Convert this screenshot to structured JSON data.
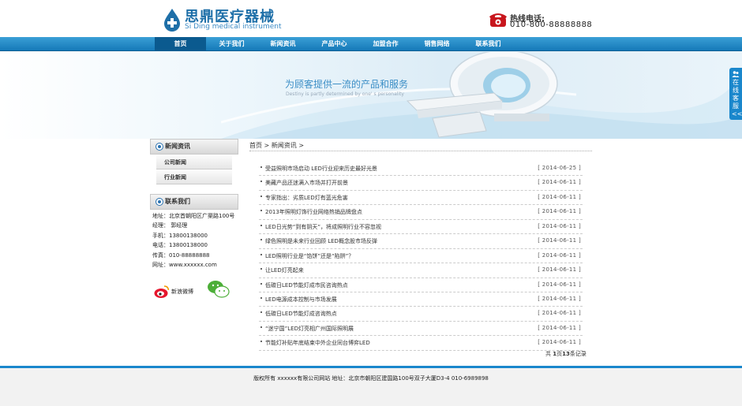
{
  "header": {
    "logo_cn": "思鼎医疗器械",
    "logo_en": "Si Ding medical instrument",
    "hotline_label": "热线电话:",
    "hotline_number": "010-800-88888888"
  },
  "nav": {
    "items": [
      {
        "label": "首页"
      },
      {
        "label": "关于我们"
      },
      {
        "label": "新闻资讯"
      },
      {
        "label": "产品中心"
      },
      {
        "label": "加盟合作"
      },
      {
        "label": "销售网络"
      },
      {
        "label": "联系我们"
      }
    ]
  },
  "banner": {
    "title": "为顾客提供一流的产品和服务",
    "subtitle": "Destiny is partly determined by one' s personality"
  },
  "side_service": {
    "text": "在线客服",
    "arrow": "<<"
  },
  "sidebar": {
    "news_heading": "新闻资讯",
    "news_items": [
      {
        "label": "公司新闻"
      },
      {
        "label": "行业新闻"
      }
    ],
    "contact_heading": "联系我们",
    "contact_lines": [
      "地址：北京首朝阳区广渠路100号",
      "经理：  郭经理",
      "手机：13800138000",
      "电话：13800138000",
      "传真：010-88888888",
      "网址：www.xxxxxx.com"
    ],
    "weibo_label": "新浪微博"
  },
  "main": {
    "breadcrumb": "首页 > 新闻资讯 >",
    "news": [
      {
        "title": "受益照明市场启动 LED行业迎来历史最好光景",
        "date": "[ 2014-06-25 ]"
      },
      {
        "title": "美藏产品还迷满入市场并打开前景",
        "date": "[ 2014-06-11 ]"
      },
      {
        "title": "专家指出：劣质LED灯有蓝光危害",
        "date": "[ 2014-06-11 ]"
      },
      {
        "title": "2013年照明灯饰行业网络热销品牌盘点",
        "date": "[ 2014-06-11 ]"
      },
      {
        "title": "LED日光势“到有阴天”，将成照明行业不容忽视",
        "date": "[ 2014-06-11 ]"
      },
      {
        "title": "绿色照明是未来行业回顾 LED概念股市场反弹",
        "date": "[ 2014-06-11 ]"
      },
      {
        "title": "LED照明行业是“馅饼”还是“陷阱”？",
        "date": "[ 2014-06-11 ]"
      },
      {
        "title": "让LED灯亮起来",
        "date": "[ 2014-06-11 ]"
      },
      {
        "title": "低碳日LED节能灯成市民咨询热点",
        "date": "[ 2014-06-11 ]"
      },
      {
        "title": "LED电源成本控制与市场发展",
        "date": "[ 2014-06-11 ]"
      },
      {
        "title": "低碳日LED节能灯成咨询热点",
        "date": "[ 2014-06-11 ]"
      },
      {
        "title": "“迷宁国”LED灯亮相广州国际照明展",
        "date": "[ 2014-06-11 ]"
      },
      {
        "title": "节能灯补贴年底结束中外企业同台博弈LED",
        "date": "[ 2014-06-11 ]"
      }
    ],
    "pager_prefix": "共",
    "pager_current": "1",
    "pager_mid": "页",
    "pager_total": "13",
    "pager_suffix": "条记录"
  },
  "footer": {
    "text": "版权所有 xxxxxx有限公司网站  地址：北京市朝阳区建国路100号双子大厦D3-4 010-6989898"
  },
  "colors": {
    "brand_blue": "#1a87cc",
    "nav_active": "#0b5a8f"
  }
}
